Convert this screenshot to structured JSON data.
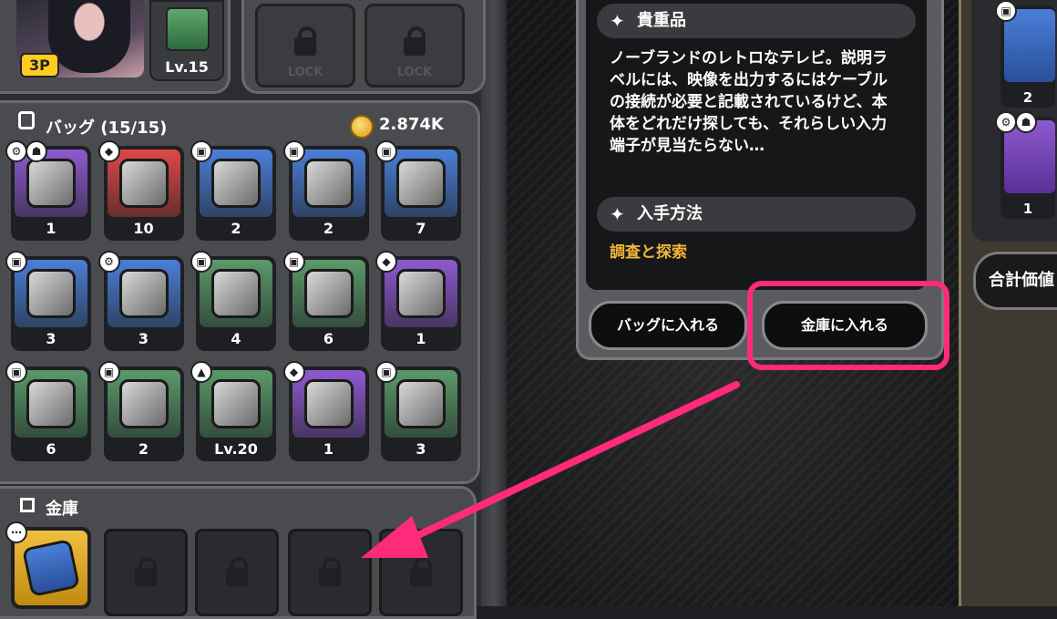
{
  "character": {
    "badge": "3P",
    "item_level": "Lv.15",
    "locked_slots": [
      "LOCK",
      "LOCK"
    ]
  },
  "bag": {
    "title": "バッグ (15/15)",
    "currency": "2.874K",
    "items": [
      {
        "name": "orb-pad-icon",
        "qty": "1",
        "color": "#8e5ad0",
        "tags": [
          "gear",
          "ghost"
        ]
      },
      {
        "name": "retro-tv-icon",
        "qty": "10",
        "color": "#e04848",
        "tags": [
          "diamond"
        ]
      },
      {
        "name": "battery-pack-icon",
        "qty": "2",
        "color": "#4a7fd8",
        "tags": [
          "cube"
        ]
      },
      {
        "name": "canister-icon",
        "qty": "2",
        "color": "#4a7fd8",
        "tags": [
          "cube"
        ]
      },
      {
        "name": "usb-drive-icon",
        "qty": "7",
        "color": "#4a7fd8",
        "tags": [
          "cube"
        ]
      },
      {
        "name": "blue-orb-icon",
        "qty": "3",
        "color": "#4a7fd8",
        "tags": [
          "cube"
        ]
      },
      {
        "name": "battery-cell-icon",
        "qty": "3",
        "color": "#4a7fd8",
        "tags": [
          "gear"
        ]
      },
      {
        "name": "box-icon",
        "qty": "4",
        "color": "#5a9a6a",
        "tags": [
          "cube"
        ]
      },
      {
        "name": "jar-icon",
        "qty": "6",
        "color": "#5a9a6a",
        "tags": [
          "cube"
        ]
      },
      {
        "name": "card-icon",
        "qty": "1",
        "color": "#8e5ad0",
        "tags": [
          "diamond"
        ]
      },
      {
        "name": "rock-icon",
        "qty": "6",
        "color": "#5a9a6a",
        "tags": [
          "cube"
        ]
      },
      {
        "name": "cup-icon",
        "qty": "2",
        "color": "#5a9a6a",
        "tags": [
          "cube"
        ]
      },
      {
        "name": "chip-icon",
        "qty": "Lv.20",
        "color": "#5a9a6a",
        "tags": [
          "up"
        ]
      },
      {
        "name": "card-icon",
        "qty": "1",
        "color": "#8e5ad0",
        "tags": [
          "diamond"
        ]
      },
      {
        "name": "launcher-icon",
        "qty": "3",
        "color": "#5a9a6a",
        "tags": [
          "cube"
        ]
      }
    ]
  },
  "vault": {
    "title": "金庫"
  },
  "detail": {
    "category_header": "貴重品",
    "description": "ノーブランドのレトロなテレビ。説明ラベルには、映像を出力するにはケーブルの接続が必要と記載されているけど、本体をどれだけ探しても、それらしい入力端子が見当たらない…",
    "obtain_header": "入手方法",
    "obtain_text": "調査と探索",
    "bag_button": "バッグに入れる",
    "vault_button": "金庫に入れる"
  },
  "right_panel": {
    "slot_qtys": [
      "2",
      "1"
    ],
    "total_label": "合計価値"
  },
  "colors": {
    "highlight": "#ff2a7a",
    "obtain_text": "#f2b53a",
    "badge": "#ffcc22"
  }
}
